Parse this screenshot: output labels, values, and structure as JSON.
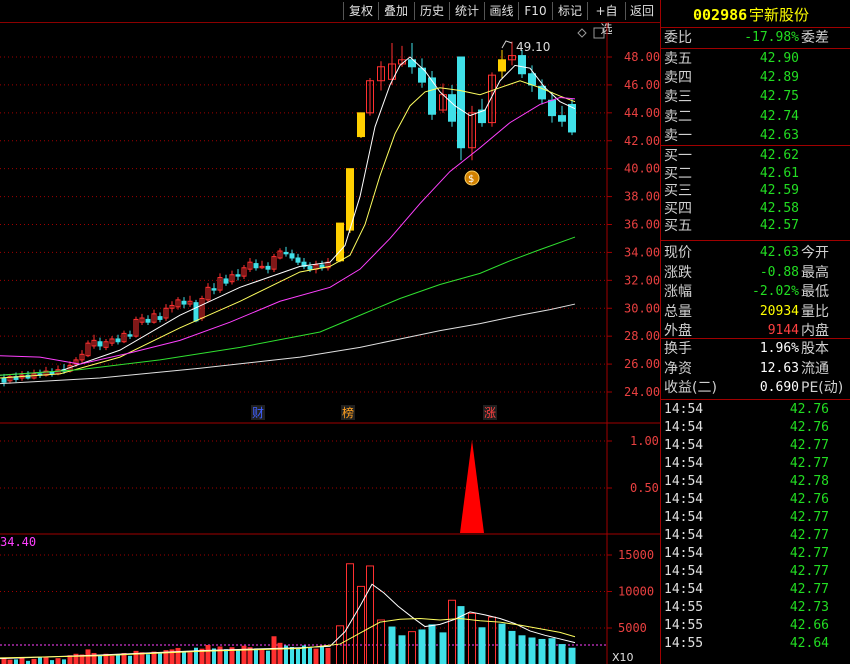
{
  "toolbar": {
    "items": [
      "复权",
      "叠加",
      "历史",
      "统计",
      "画线",
      "F10",
      "标记",
      "+自选",
      "返回"
    ]
  },
  "stock": {
    "code": "002986",
    "name": "宇新股份"
  },
  "weibi": {
    "label": "委比",
    "value": "-17.98%",
    "label2": "委差"
  },
  "asks": [
    {
      "label": "卖五",
      "price": "42.90"
    },
    {
      "label": "卖四",
      "price": "42.89"
    },
    {
      "label": "卖三",
      "price": "42.75"
    },
    {
      "label": "卖二",
      "price": "42.74"
    },
    {
      "label": "卖一",
      "price": "42.63"
    }
  ],
  "bids": [
    {
      "label": "买一",
      "price": "42.62"
    },
    {
      "label": "买二",
      "price": "42.61"
    },
    {
      "label": "买三",
      "price": "42.59"
    },
    {
      "label": "买四",
      "price": "42.58"
    },
    {
      "label": "买五",
      "price": "42.57"
    }
  ],
  "quote": [
    {
      "label": "现价",
      "value": "42.63",
      "label2": "今开",
      "color": "green"
    },
    {
      "label": "涨跌",
      "value": "-0.88",
      "label2": "最高",
      "color": "green"
    },
    {
      "label": "涨幅",
      "value": "-2.02%",
      "label2": "最低",
      "color": "green"
    },
    {
      "label": "总量",
      "value": "20934",
      "label2": "量比",
      "color": "yellow"
    },
    {
      "label": "外盘",
      "value": "9144",
      "label2": "内盘",
      "color": "red"
    }
  ],
  "fundamentals": [
    {
      "label": "换手",
      "value": "1.96%",
      "label2": "股本"
    },
    {
      "label": "净资",
      "value": "12.63",
      "label2": "流通"
    },
    {
      "label": "收益(二)",
      "value": "0.690",
      "label2": "PE(动)"
    }
  ],
  "ticks": [
    {
      "time": "14:54",
      "price": "42.76"
    },
    {
      "time": "14:54",
      "price": "42.76"
    },
    {
      "time": "14:54",
      "price": "42.77"
    },
    {
      "time": "14:54",
      "price": "42.77"
    },
    {
      "time": "14:54",
      "price": "42.78"
    },
    {
      "time": "14:54",
      "price": "42.76"
    },
    {
      "time": "14:54",
      "price": "42.77"
    },
    {
      "time": "14:54",
      "price": "42.77"
    },
    {
      "time": "14:54",
      "price": "42.77"
    },
    {
      "time": "14:54",
      "price": "42.77"
    },
    {
      "time": "14:54",
      "price": "42.77"
    },
    {
      "time": "14:55",
      "price": "42.73"
    },
    {
      "time": "14:55",
      "price": "42.66"
    },
    {
      "time": "14:55",
      "price": "42.64"
    }
  ],
  "chart": {
    "price_axis": [
      "48.00",
      "46.00",
      "44.00",
      "42.00",
      "40.00",
      "38.00",
      "36.00",
      "34.00",
      "32.00",
      "30.00",
      "28.00",
      "26.00",
      "24.00"
    ],
    "high_label": "49.10",
    "markers": [
      "财",
      "榜",
      "涨"
    ],
    "indicator_axis": [
      "1.00",
      "0.50"
    ],
    "volume_axis": [
      "15000",
      "10000",
      "5000"
    ],
    "volume_top_label": "34.40",
    "volume_unit": "X10"
  },
  "colors": {
    "up": "#ff3030",
    "down": "#40e0e8",
    "limit": "#ffd000",
    "ma5": "#ffffff",
    "ma10": "#ffff60",
    "ma20": "#ff40ff",
    "ma60": "#30e030",
    "ma120": "#e0e0e0",
    "grid": "#a00000"
  }
}
